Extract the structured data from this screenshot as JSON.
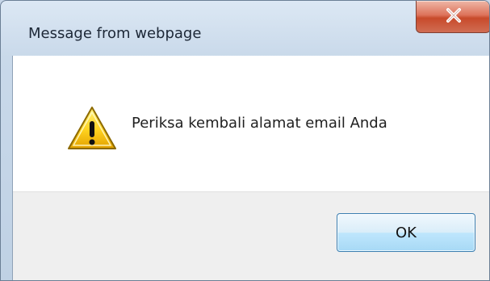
{
  "dialog": {
    "title": "Message from webpage",
    "message": "Periksa kembali alamat email Anda",
    "ok_label": "OK",
    "icons": {
      "close": "close-icon",
      "warning": "warning-icon"
    },
    "colors": {
      "close_button": "#dd735b",
      "ok_button": "#bee6fd",
      "warning_fill": "#ffd21f"
    }
  }
}
